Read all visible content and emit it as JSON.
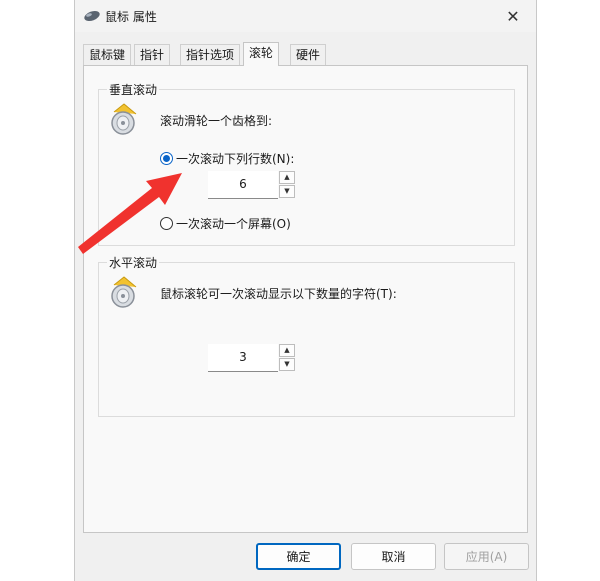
{
  "window": {
    "title": "鼠标 属性",
    "close_symbol": "✕"
  },
  "tabs": [
    {
      "label": "鼠标键"
    },
    {
      "label": "指针"
    },
    {
      "label": "指针选项"
    },
    {
      "label": "滚轮"
    },
    {
      "label": "硬件"
    }
  ],
  "vertical": {
    "title": "垂直滚动",
    "prompt": "滚动滑轮一个齿格到:",
    "option_lines": "一次滚动下列行数(N):",
    "lines_value": "6",
    "option_screen": "一次滚动一个屏幕(O)"
  },
  "horizontal": {
    "title": "水平滚动",
    "prompt": "鼠标滚轮可一次滚动显示以下数量的字符(T):",
    "chars_value": "3"
  },
  "buttons": {
    "ok": "确定",
    "cancel": "取消",
    "apply": "应用(A)"
  },
  "spin": {
    "up": "▲",
    "down": "▼"
  },
  "colors": {
    "accent": "#0067c0",
    "arrow": "#f0322e"
  }
}
